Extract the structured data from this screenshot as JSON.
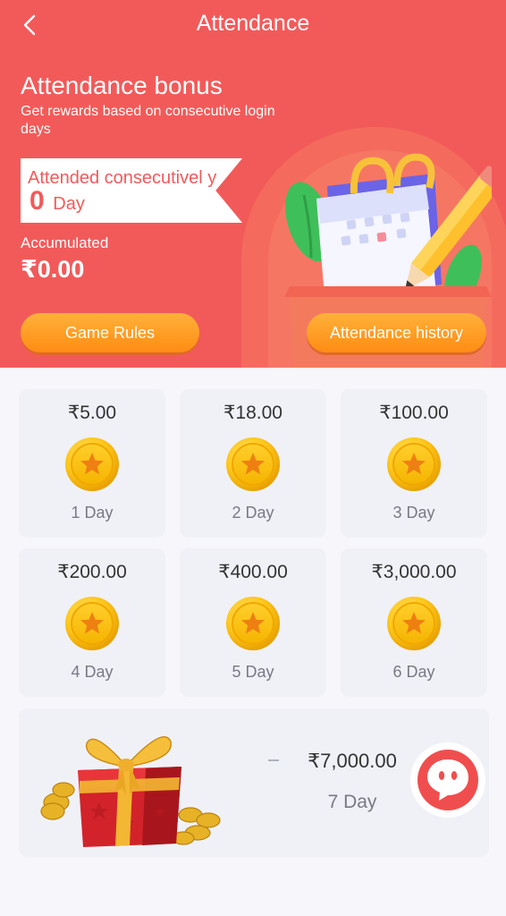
{
  "header": {
    "title": "Attendance"
  },
  "bonus": {
    "title": "Attendance bonus",
    "subtitle": "Get rewards based on consecutive login days",
    "streak_prefix": "Attended consecutivel y",
    "streak_days": "0",
    "streak_suffix": "Day",
    "accumulated_label": "Accumulated",
    "accumulated_amount": "₹0.00"
  },
  "buttons": {
    "game_rules": "Game Rules",
    "attendance_history": "Attendance history"
  },
  "rewards": [
    {
      "amount": "₹5.00",
      "day": "1 Day"
    },
    {
      "amount": "₹18.00",
      "day": "2 Day"
    },
    {
      "amount": "₹100.00",
      "day": "3 Day"
    },
    {
      "amount": "₹200.00",
      "day": "4 Day"
    },
    {
      "amount": "₹400.00",
      "day": "5 Day"
    },
    {
      "amount": "₹3,000.00",
      "day": "6 Day"
    },
    {
      "amount": "₹7,000.00",
      "day": "7 Day"
    }
  ],
  "icons": {
    "back": "back-icon",
    "coin": "coin-icon",
    "gift": "gift-icon",
    "calendar": "calendar-icon",
    "chat": "chat-icon"
  },
  "colors": {
    "header_red": "#f25a5a",
    "button_orange": "#ff8c13",
    "coin_gold": "#f5b400",
    "card_bg": "#f0f1f7",
    "page_bg": "#f6f6fb"
  }
}
